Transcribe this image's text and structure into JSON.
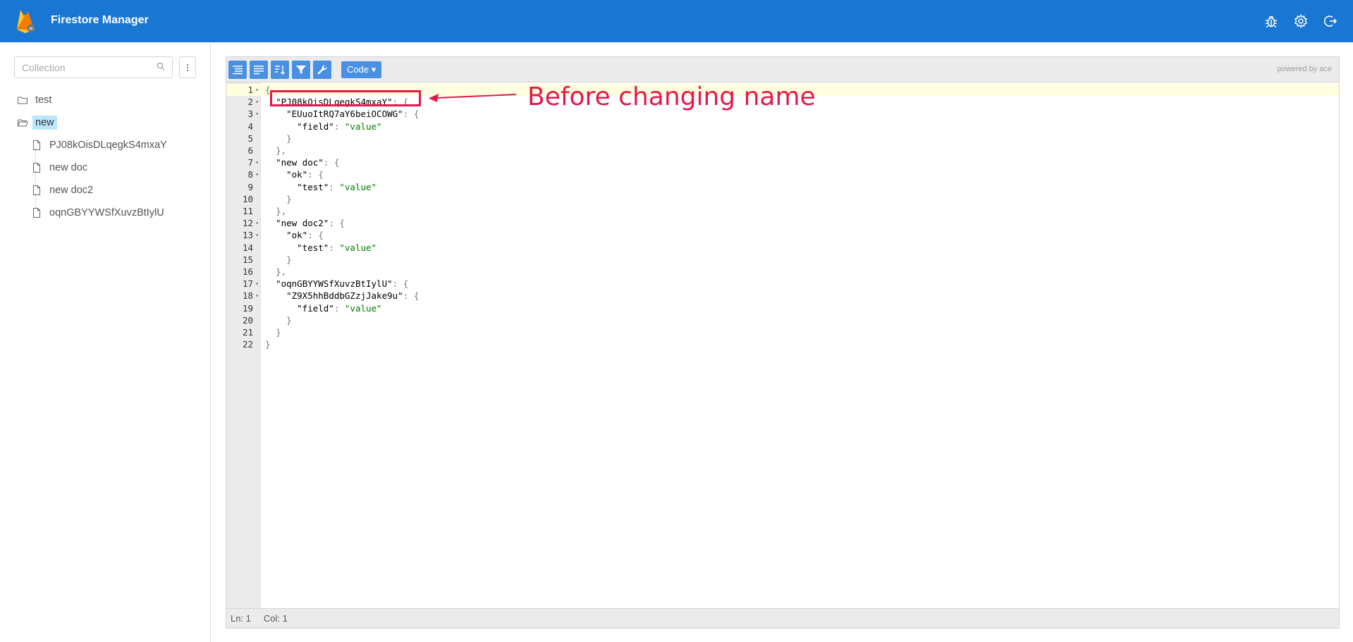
{
  "header": {
    "title": "Firestore Manager",
    "actions": [
      "bug-icon",
      "gear-icon",
      "logout-icon"
    ],
    "color": "#1976d2"
  },
  "sidebar": {
    "search_placeholder": "Collection",
    "tree": [
      {
        "label": "test",
        "type": "folder",
        "expanded": false
      },
      {
        "label": "new",
        "type": "folder",
        "expanded": true,
        "selected": true,
        "children": [
          "PJ08kOisDLqegkS4mxaY",
          "new doc",
          "new doc2",
          "oqnGBYYWSfXuvzBtIylU"
        ]
      }
    ]
  },
  "editor": {
    "mode_label": "Code ▾",
    "powered_by": "powered by ace",
    "status": {
      "ln": "Ln: 1",
      "col": "Col: 1"
    },
    "lines": [
      {
        "n": "1",
        "fold": true,
        "html": "<span class='punc'>{</span>"
      },
      {
        "n": "2",
        "fold": true,
        "html": "  <span class='key'>\"PJ08kOisDLqegkS4mxaY\"</span><span class='punc'>: {</span>"
      },
      {
        "n": "3",
        "fold": true,
        "html": "    <span class='key'>\"EUuoItRQ7aY6beiOCOWG\"</span><span class='punc'>: {</span>"
      },
      {
        "n": "4",
        "fold": false,
        "html": "      <span class='key'>\"field\"</span><span class='punc'>: </span><span class='str'>\"value\"</span>"
      },
      {
        "n": "5",
        "fold": false,
        "html": "    <span class='punc'>}</span>"
      },
      {
        "n": "6",
        "fold": false,
        "html": "  <span class='punc'>},</span>"
      },
      {
        "n": "7",
        "fold": true,
        "html": "  <span class='key'>\"new doc\"</span><span class='punc'>: {</span>"
      },
      {
        "n": "8",
        "fold": true,
        "html": "    <span class='key'>\"ok\"</span><span class='punc'>: {</span>"
      },
      {
        "n": "9",
        "fold": false,
        "html": "      <span class='key'>\"test\"</span><span class='punc'>: </span><span class='str'>\"value\"</span>"
      },
      {
        "n": "10",
        "fold": false,
        "html": "    <span class='punc'>}</span>"
      },
      {
        "n": "11",
        "fold": false,
        "html": "  <span class='punc'>},</span>"
      },
      {
        "n": "12",
        "fold": true,
        "html": "  <span class='key'>\"new doc2\"</span><span class='punc'>: {</span>"
      },
      {
        "n": "13",
        "fold": true,
        "html": "    <span class='key'>\"ok\"</span><span class='punc'>: {</span>"
      },
      {
        "n": "14",
        "fold": false,
        "html": "      <span class='key'>\"test\"</span><span class='punc'>: </span><span class='str'>\"value\"</span>"
      },
      {
        "n": "15",
        "fold": false,
        "html": "    <span class='punc'>}</span>"
      },
      {
        "n": "16",
        "fold": false,
        "html": "  <span class='punc'>},</span>"
      },
      {
        "n": "17",
        "fold": true,
        "html": "  <span class='key'>\"oqnGBYYWSfXuvzBtIylU\"</span><span class='punc'>: {</span>"
      },
      {
        "n": "18",
        "fold": true,
        "html": "    <span class='key'>\"Z9X5hhBddbGZzjJake9u\"</span><span class='punc'>: {</span>"
      },
      {
        "n": "19",
        "fold": false,
        "html": "      <span class='key'>\"field\"</span><span class='punc'>: </span><span class='str'>\"value\"</span>"
      },
      {
        "n": "20",
        "fold": false,
        "html": "    <span class='punc'>}</span>"
      },
      {
        "n": "21",
        "fold": false,
        "html": "  <span class='punc'>}</span>"
      },
      {
        "n": "22",
        "fold": false,
        "html": "<span class='punc'>}</span>"
      }
    ]
  },
  "annotation": {
    "text": "Before changing name",
    "color": "#e8174a"
  }
}
